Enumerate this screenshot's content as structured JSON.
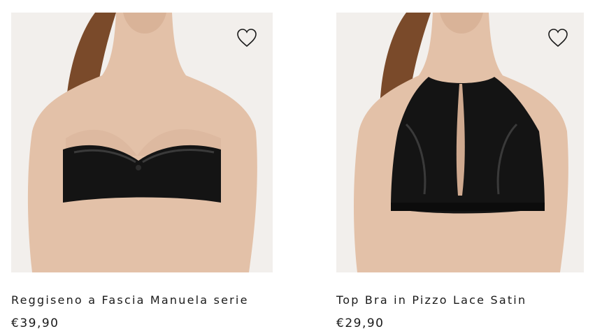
{
  "products": [
    {
      "name": "Reggiseno a Fascia Manuela serie",
      "price": "€39,90",
      "image_alt": "bandeau-bra-black-lace",
      "wishlist_icon": "heart-outline-icon"
    },
    {
      "name": "Top Bra in Pizzo Lace Satin",
      "price": "€29,90",
      "image_alt": "lace-top-bra-black",
      "wishlist_icon": "heart-outline-icon"
    }
  ],
  "colors": {
    "text": "#1a1a1a",
    "photo_bg": "#f2efec",
    "skin": "#e3c1a8",
    "hair": "#7a4a2a",
    "garment": "#141414"
  }
}
